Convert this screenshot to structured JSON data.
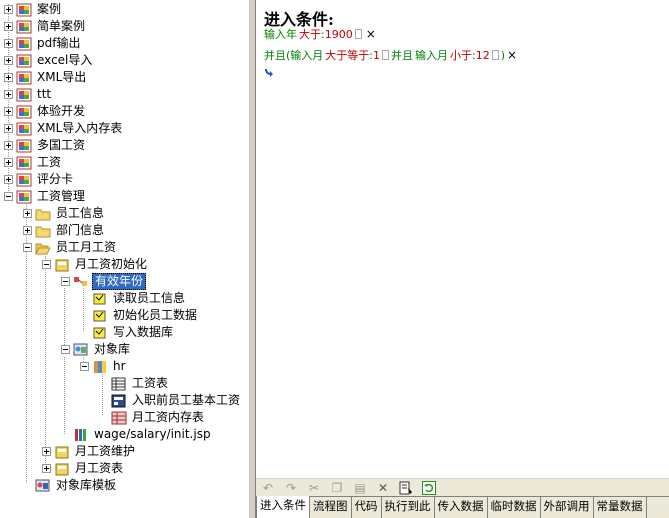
{
  "tree": {
    "items": [
      {
        "label": "案例",
        "state": "plus",
        "icon": "project-icon"
      },
      {
        "label": "简单案例",
        "state": "plus",
        "icon": "project-icon"
      },
      {
        "label": "pdf输出",
        "state": "plus",
        "icon": "project-icon"
      },
      {
        "label": "excel导入",
        "state": "plus",
        "icon": "project-icon"
      },
      {
        "label": "XML导出",
        "state": "plus",
        "icon": "project-icon"
      },
      {
        "label": "ttt",
        "state": "plus",
        "icon": "project-icon"
      },
      {
        "label": "体验开发",
        "state": "plus",
        "icon": "project-icon"
      },
      {
        "label": "XML导入内存表",
        "state": "plus",
        "icon": "project-icon"
      },
      {
        "label": "多国工资",
        "state": "plus",
        "icon": "project-icon"
      },
      {
        "label": "工资",
        "state": "plus",
        "icon": "project-icon"
      },
      {
        "label": "评分卡",
        "state": "plus",
        "icon": "project-icon"
      },
      {
        "label": "工资管理",
        "state": "minus",
        "icon": "project-icon"
      },
      {
        "label": "员工信息",
        "state": "plus",
        "icon": "folder-icon"
      },
      {
        "label": "部门信息",
        "state": "plus",
        "icon": "folder-icon"
      },
      {
        "label": "员工月工资",
        "state": "minus",
        "icon": "folder-open-icon"
      },
      {
        "label": "月工资初始化",
        "state": "minus",
        "icon": "module-icon"
      },
      {
        "label": "有效年份",
        "state": "minus",
        "icon": "flow-icon",
        "selected": true
      },
      {
        "label": "读取员工信息",
        "state": "none",
        "icon": "step-icon"
      },
      {
        "label": "初始化员工数据",
        "state": "none",
        "icon": "step-icon"
      },
      {
        "label": "写入数据库",
        "state": "none",
        "icon": "step-icon"
      },
      {
        "label": "对象库",
        "state": "minus",
        "icon": "object-library-icon"
      },
      {
        "label": "hr",
        "state": "minus",
        "icon": "database-icon"
      },
      {
        "label": "工资表",
        "state": "none",
        "icon": "table-icon"
      },
      {
        "label": "入职前员工基本工资",
        "state": "none",
        "icon": "form-icon"
      },
      {
        "label": "月工资内存表",
        "state": "none",
        "icon": "memory-table-icon"
      },
      {
        "label": "wage/salary/init.jsp",
        "state": "none",
        "icon": "page-icon"
      },
      {
        "label": "月工资维护",
        "state": "plus",
        "icon": "module-icon"
      },
      {
        "label": "月工资表",
        "state": "plus",
        "icon": "module-icon"
      },
      {
        "label": "对象库模板",
        "state": "none",
        "icon": "template-icon"
      }
    ]
  },
  "conditions": {
    "title": "进入条件:",
    "line1": {
      "a": "输入年",
      "op": "大于",
      "val": "1900"
    },
    "line2": {
      "prefix": "并且(",
      "a": "输入月",
      "op1": "大于等于",
      "v1": "1",
      "and": "并且",
      "b": "输入月",
      "op2": "小于",
      "v2": "12",
      "suffix": ")"
    },
    "close": "×"
  },
  "toolbar": [
    "undo-icon",
    "redo-icon",
    "cut-icon",
    "copy-icon",
    "paste-icon",
    "delete-icon",
    "properties-icon",
    "refresh-icon"
  ],
  "tabs": [
    "进入条件",
    "流程图",
    "代码",
    "执行到此",
    "传入数据",
    "临时数据",
    "外部调用",
    "常量数据"
  ],
  "colors": {
    "selection": "#316ac5",
    "green": "#008000",
    "red": "#c00000"
  }
}
